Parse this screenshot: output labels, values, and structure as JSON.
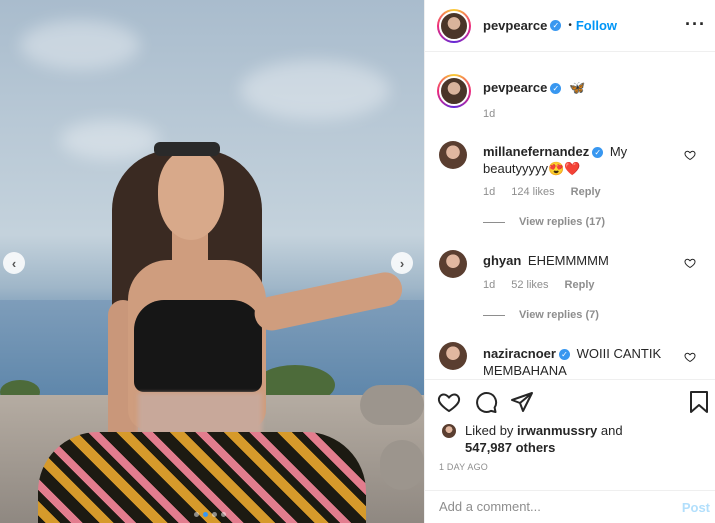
{
  "post": {
    "username": "pevpearce",
    "follow_separator": "•",
    "follow_label": "Follow",
    "caption_emoji": "🦋",
    "caption_age": "1d",
    "image_count": 4,
    "active_image_index": 1
  },
  "comments": [
    {
      "username": "millanefernandez",
      "verified": true,
      "text_line1": "My",
      "text_line2": "beautyyyyy😍❤️",
      "age": "1d",
      "likes": "124 likes",
      "reply_label": "Reply",
      "view_replies": "View replies (17)"
    },
    {
      "username": "ghyan",
      "verified": false,
      "text_line1": "EHEMMMMM",
      "age": "1d",
      "likes": "52 likes",
      "reply_label": "Reply",
      "view_replies": "View replies (7)"
    },
    {
      "username": "naziracnoer",
      "verified": true,
      "text_line1": "WOIII CANTIK",
      "text_line2": "MEMBAHANA"
    }
  ],
  "likes": {
    "prefix": "Liked by",
    "liker": "irwanmussry",
    "suffix": "and",
    "others": "547,987 others"
  },
  "date": "1 DAY AGO",
  "composer": {
    "placeholder": "Add a comment...",
    "post_label": "Post"
  },
  "icons": {
    "verified": "verified-badge-icon",
    "more": "more-options-icon",
    "heart": "heart-icon",
    "comment": "comment-icon",
    "share": "share-icon",
    "save": "bookmark-icon",
    "prev": "chevron-left-icon",
    "next": "chevron-right-icon"
  },
  "colors": {
    "link_blue": "#0095f6",
    "verified_blue": "#3897f0",
    "muted": "#8e8e8e",
    "post_disabled": "#b2dffc"
  }
}
